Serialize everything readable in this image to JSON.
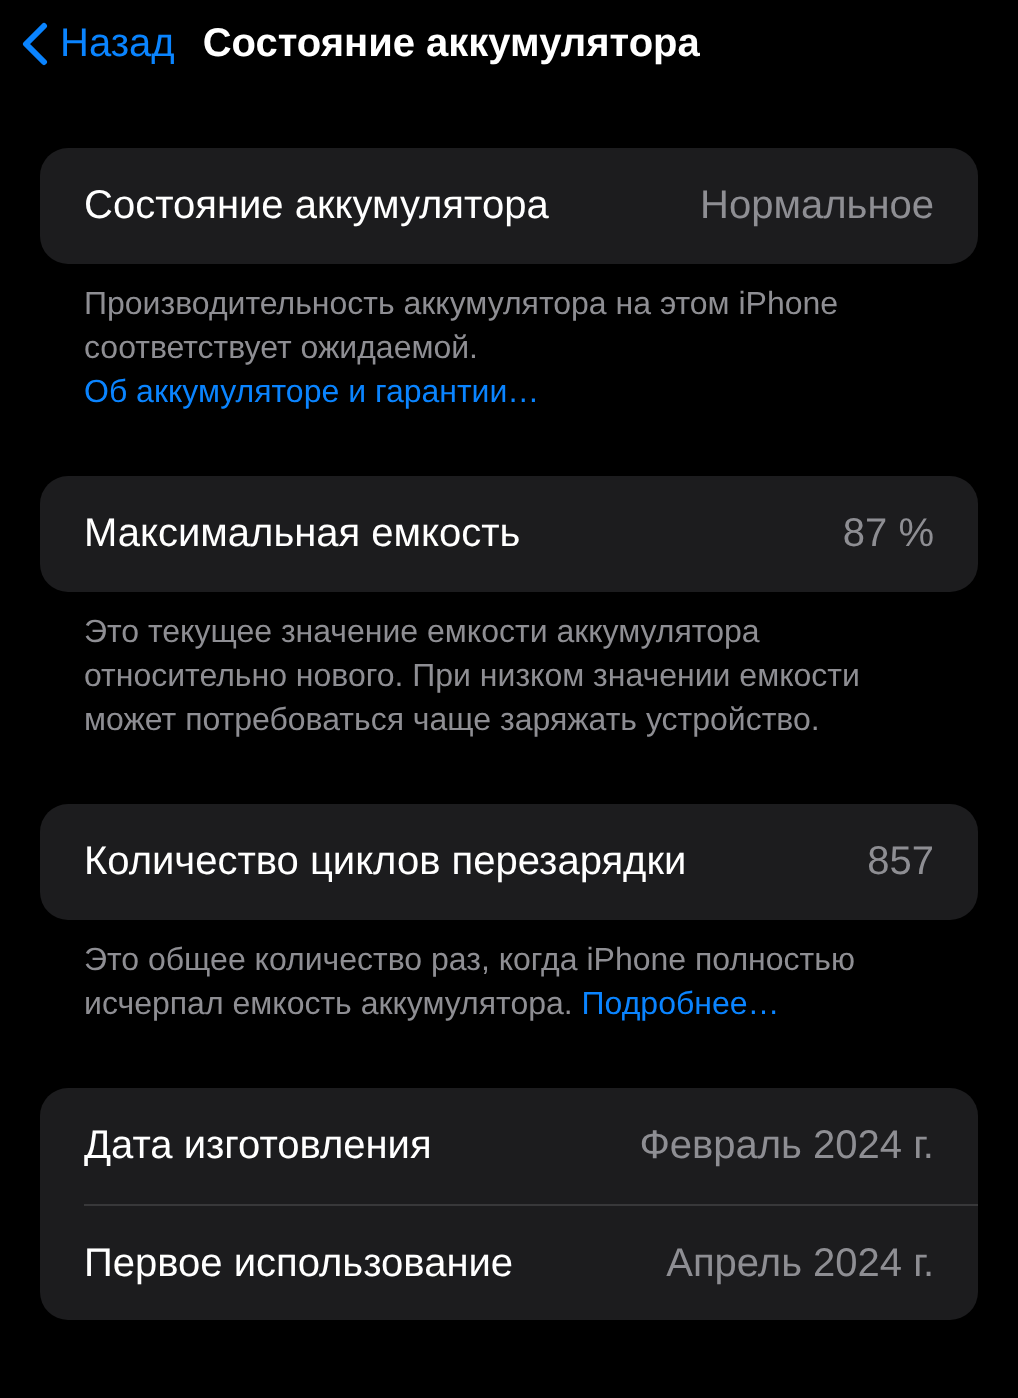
{
  "header": {
    "back_label": "Назад",
    "title": "Состояние аккумулятора"
  },
  "sections": [
    {
      "rows": [
        {
          "label": "Состояние аккумулятора",
          "value": "Нормальное"
        }
      ],
      "footer": [
        {
          "kind": "text",
          "text": "Производительность аккумулятора на этом iPhone соответствует ожидаемой. "
        },
        {
          "kind": "link",
          "text": "Об аккумуляторе и гарантии…"
        }
      ]
    },
    {
      "rows": [
        {
          "label": "Максимальная емкость",
          "value": "87 %"
        }
      ],
      "footer": [
        {
          "kind": "text",
          "text": "Это текущее значение емкости аккумулятора относительно нового. При низком значении емкости может потребоваться чаще заряжать устройство."
        }
      ]
    },
    {
      "rows": [
        {
          "label": "Количество циклов перезарядки",
          "value": "857"
        }
      ],
      "footer": [
        {
          "kind": "text",
          "text": "Это общее количество раз, когда iPhone полностью исчерпал емкость аккумулятора. "
        },
        {
          "kind": "link",
          "text": "Подробнее…"
        }
      ]
    },
    {
      "rows": [
        {
          "label": "Дата изготовления",
          "value": "Февраль 2024 г."
        },
        {
          "label": "Первое использование",
          "value": "Апрель 2024 г."
        }
      ]
    }
  ]
}
